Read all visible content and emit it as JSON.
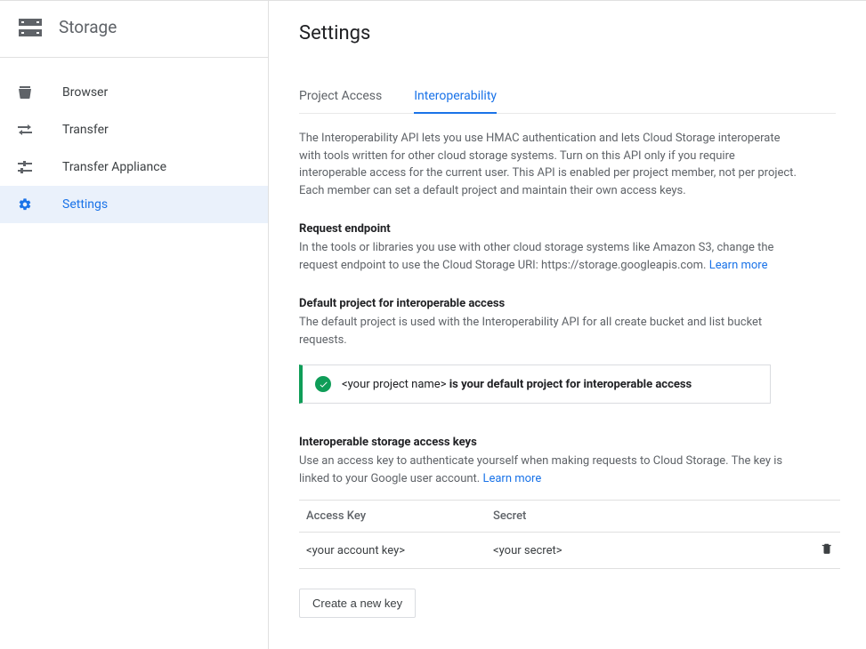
{
  "sidebar": {
    "title": "Storage",
    "items": [
      {
        "label": "Browser"
      },
      {
        "label": "Transfer"
      },
      {
        "label": "Transfer Appliance"
      },
      {
        "label": "Settings"
      }
    ]
  },
  "page": {
    "title": "Settings",
    "tabs": [
      {
        "label": "Project Access"
      },
      {
        "label": "Interoperability"
      }
    ],
    "intro": "The Interoperability API lets you use HMAC authentication and lets Cloud Storage interoperate with tools written for other cloud storage systems. Turn on this API only if you require interoperable access for the current user. This API is enabled per project member, not per project. Each member can set a default project and maintain their own access keys.",
    "request_endpoint": {
      "heading": "Request endpoint",
      "body_prefix": "In the tools or libraries you use with other cloud storage systems like Amazon S3, change the request endpoint to use the Cloud Storage URI: https://storage.googleapis.com. ",
      "learn_more": "Learn more"
    },
    "default_project": {
      "heading": "Default project for interoperable access",
      "body": "The default project is used with the Interoperability API for all create bucket and list bucket requests.",
      "info_prefix": "<your project name>  ",
      "info_bold": "is your default project for interoperable access"
    },
    "access_keys": {
      "heading": "Interoperable storage access keys",
      "body_prefix": "Use an access key to authenticate yourself when making requests to Cloud Storage. The key is linked to your Google user account. ",
      "learn_more": "Learn more",
      "columns": {
        "key": "Access Key",
        "secret": "Secret"
      },
      "row": {
        "key": "<your account key>",
        "secret": "<your secret>"
      },
      "create_button": "Create a new key"
    }
  }
}
